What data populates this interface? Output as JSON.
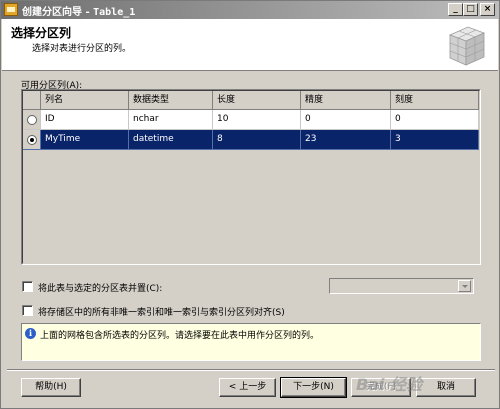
{
  "window": {
    "title": "创建分区向导",
    "title_separator": " - ",
    "title_sub": "Table_1",
    "controls": {
      "minimize": "_",
      "maximize": "□",
      "close": "×"
    }
  },
  "header": {
    "title": "选择分区列",
    "description": "选择对表进行分区的列。"
  },
  "columns_group": {
    "label": "可用分区列(A):",
    "headers": [
      "列名",
      "数据类型",
      "长度",
      "精度",
      "刻度"
    ],
    "rows": [
      {
        "selected": false,
        "name": "ID",
        "type": "nchar",
        "length": "10",
        "precision": "0",
        "scale": "0"
      },
      {
        "selected": true,
        "name": "MyTime",
        "type": "datetime",
        "length": "8",
        "precision": "23",
        "scale": "3"
      }
    ]
  },
  "options": {
    "collocate_label": "将此表与选定的分区表并置(C):",
    "collocate_checked": false,
    "collocate_select_value": "",
    "align_label": "将存储区中的所有非唯一索引和唯一索引与索引分区列对齐(S)",
    "align_checked": false
  },
  "info": {
    "icon": "info-icon",
    "text": "上面的网格包含所选表的分区列。请选择要在此表中用作分区列的列。"
  },
  "footer": {
    "help": "帮助(H)",
    "back": "< 上一步",
    "next": "下一步(N)",
    "finish": "完成(F)",
    "cancel": "取消"
  },
  "watermark": "Bai 经验",
  "colors": {
    "selection": "#0a246a",
    "dialog_bg": "#d4d0c8",
    "info_bg": "#ffffe1"
  }
}
